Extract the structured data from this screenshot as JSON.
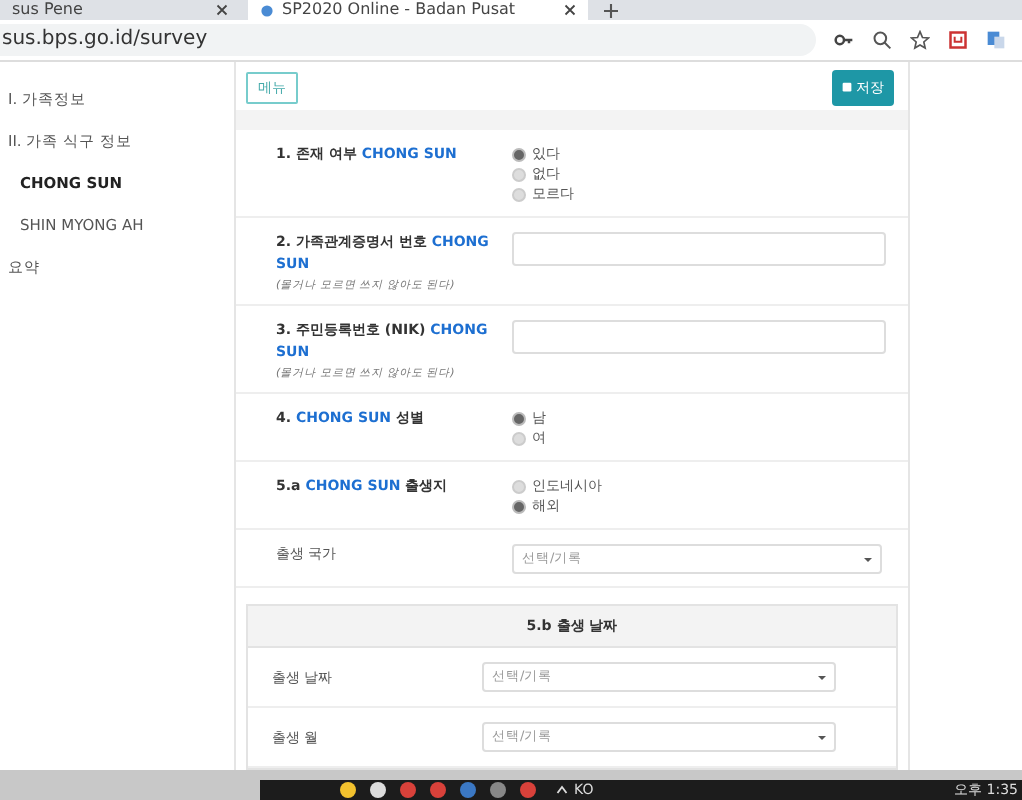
{
  "browser": {
    "tabs": [
      {
        "title": "sus Pene",
        "selected": false
      },
      {
        "title": "SP2020 Online - Badan Pusat",
        "selected": true
      }
    ],
    "address": "sus.bps.go.id/survey"
  },
  "sidebar": {
    "items": [
      {
        "label": "I. 가족정보",
        "selected": false
      },
      {
        "label": "II. 가족 식구 정보",
        "selected": false,
        "children": [
          {
            "label": "CHONG SUN",
            "selected": true
          },
          {
            "label": "SHIN MYONG AH",
            "selected": false
          }
        ]
      },
      {
        "label": "요약",
        "selected": false
      }
    ]
  },
  "toolbar": {
    "menu_button": "메뉴",
    "save_button": "저장"
  },
  "questions": [
    {
      "kind": "radio",
      "label": [
        {
          "text": "1. 존재 여부 ",
          "kind": "plain"
        },
        {
          "text": "CHONG SUN",
          "kind": "name"
        }
      ],
      "options": [
        {
          "label": "있다",
          "selected": true
        },
        {
          "label": "없다",
          "selected": false
        },
        {
          "label": "모르다",
          "selected": false
        }
      ]
    },
    {
      "kind": "text",
      "label": [
        {
          "text": "2. 가족관계증명서 번호 ",
          "kind": "plain"
        },
        {
          "text": "CHONG SUN",
          "kind": "name"
        }
      ],
      "hint": "(몰거나 모르면 쓰지 않아도 된다)"
    },
    {
      "kind": "text",
      "label": [
        {
          "text": "3. 주민등록번호 (NIK) ",
          "kind": "plain"
        },
        {
          "text": "CHONG SUN",
          "kind": "name"
        }
      ],
      "hint": "(몰거나 모르면 쓰지 않아도 된다)"
    },
    {
      "kind": "radio",
      "label": [
        {
          "text": "4. ",
          "kind": "plain"
        },
        {
          "text": "CHONG SUN",
          "kind": "name"
        },
        {
          "text": " 성별",
          "kind": "plain"
        }
      ],
      "options": [
        {
          "label": "남",
          "selected": true
        },
        {
          "label": "여",
          "selected": false
        }
      ]
    },
    {
      "kind": "radio",
      "label": [
        {
          "text": "5.a ",
          "kind": "plain"
        },
        {
          "text": "CHONG SUN",
          "kind": "name"
        },
        {
          "text": " 출생지",
          "kind": "plain"
        }
      ],
      "options": [
        {
          "label": "인도네시아",
          "selected": false
        },
        {
          "label": "해외",
          "selected": true
        }
      ]
    },
    {
      "kind": "select",
      "label": [
        {
          "text": "출생 국가",
          "kind": "light"
        }
      ],
      "placeholder": "선택/기록"
    }
  ],
  "section": {
    "title": "5.b 출생 날짜",
    "rows": [
      {
        "label": "출생 날짜",
        "placeholder": "선택/기록"
      },
      {
        "label": "출생 월",
        "placeholder": "선택/기록"
      }
    ]
  },
  "taskbar": {
    "language": "KO",
    "time": "오후 1:35"
  }
}
